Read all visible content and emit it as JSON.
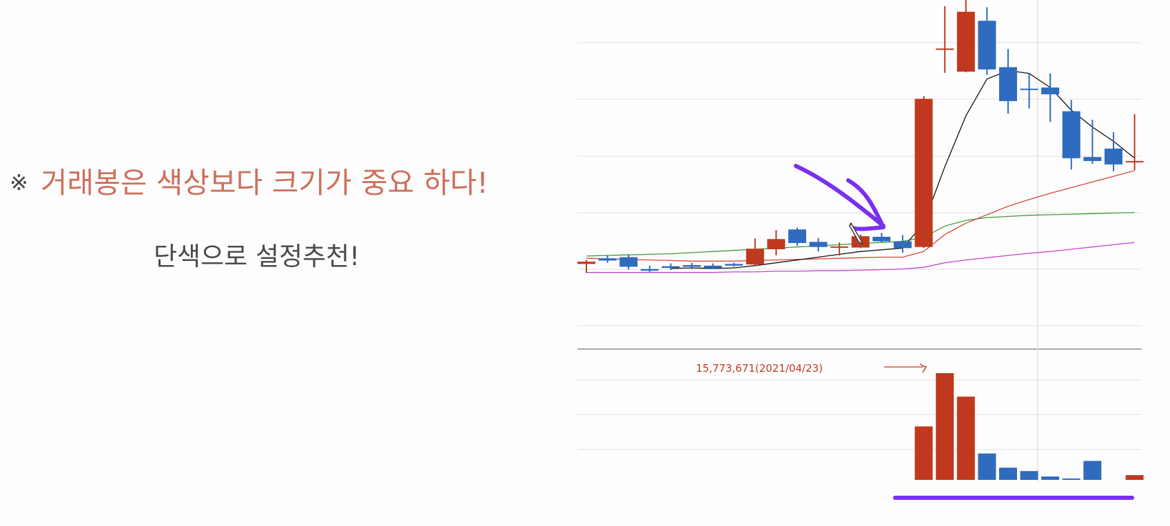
{
  "headline": {
    "mark": "※",
    "text": "거래봉은 색상보다 크기가 중요 하다!",
    "color": "#cf6f5c"
  },
  "subline": "단색으로 설정추천!",
  "chart_data": {
    "type": "candlestick",
    "colors": {
      "up": "#c0391e",
      "down": "#2f6bbf",
      "ma5": "#111111",
      "ma20": "#d9453a",
      "ma60": "#3a9a3a",
      "ma120": "#c844d0",
      "annotation": "#7b2ff0"
    },
    "candles": [
      {
        "o": 85.8,
        "h": 86.5,
        "l": 84.2,
        "c": 86.2
      },
      {
        "o": 86.8,
        "h": 87.3,
        "l": 86.0,
        "c": 86.4
      },
      {
        "o": 87.0,
        "h": 87.5,
        "l": 84.8,
        "c": 85.3
      },
      {
        "o": 84.9,
        "h": 85.5,
        "l": 84.3,
        "c": 84.6
      },
      {
        "o": 85.4,
        "h": 85.9,
        "l": 84.7,
        "c": 85.1
      },
      {
        "o": 85.6,
        "h": 86.0,
        "l": 84.9,
        "c": 85.3
      },
      {
        "o": 85.5,
        "h": 85.9,
        "l": 84.9,
        "c": 85.1
      },
      {
        "o": 85.8,
        "h": 86.0,
        "l": 85.3,
        "c": 85.5
      },
      {
        "o": 85.7,
        "h": 90.3,
        "l": 85.5,
        "c": 88.5
      },
      {
        "o": 88.4,
        "h": 91.8,
        "l": 87.3,
        "c": 90.2
      },
      {
        "o": 91.9,
        "h": 92.2,
        "l": 89.0,
        "c": 89.5
      },
      {
        "o": 89.7,
        "h": 90.4,
        "l": 88.0,
        "c": 88.8
      },
      {
        "o": 88.7,
        "h": 89.6,
        "l": 87.3,
        "c": 88.9
      },
      {
        "o": 88.7,
        "h": 91.0,
        "l": 88.6,
        "c": 90.7
      },
      {
        "o": 90.6,
        "h": 91.3,
        "l": 89.6,
        "c": 89.8
      },
      {
        "o": 89.8,
        "h": 90.9,
        "l": 87.8,
        "c": 88.6
      },
      {
        "o": 88.8,
        "h": 115.5,
        "l": 88.6,
        "c": 115.0
      },
      {
        "o": 123.8,
        "h": 131.4,
        "l": 119.6,
        "c": 123.9
      },
      {
        "o": 119.8,
        "h": 143.3,
        "l": 119.7,
        "c": 130.4
      },
      {
        "o": 128.8,
        "h": 131.2,
        "l": 119.2,
        "c": 120.2
      },
      {
        "o": 120.6,
        "h": 123.8,
        "l": 112.4,
        "c": 114.6
      },
      {
        "o": 116.8,
        "h": 119.4,
        "l": 113.3,
        "c": 116.7
      },
      {
        "o": 117.0,
        "h": 119.5,
        "l": 110.9,
        "c": 115.8
      },
      {
        "o": 112.8,
        "h": 114.8,
        "l": 102.5,
        "c": 104.5
      },
      {
        "o": 104.7,
        "h": 111.3,
        "l": 103.5,
        "c": 104.0
      },
      {
        "o": 106.2,
        "h": 109.1,
        "l": 102.2,
        "c": 103.4
      },
      {
        "o": 103.8,
        "h": 112.3,
        "l": 102.4,
        "c": 104.0
      }
    ],
    "ma5": [
      null,
      null,
      null,
      null,
      85.0,
      85.1,
      85.0,
      85.1,
      85.5,
      86.0,
      86.5,
      87.0,
      87.5,
      88.0,
      88.3,
      88.6,
      93.0,
      103.0,
      112.0,
      118.5,
      120.0,
      119.5,
      117.0,
      113.0,
      110.0,
      107.5,
      104.5
    ],
    "ma20": [
      86.8,
      86.7,
      86.6,
      86.5,
      86.4,
      86.3,
      86.3,
      86.3,
      86.4,
      86.5,
      86.6,
      86.7,
      86.8,
      86.9,
      87.0,
      87.0,
      88.0,
      91.0,
      93.0,
      94.5,
      96.0,
      97.2,
      98.3,
      99.3,
      100.3,
      101.3,
      102.3
    ],
    "ma60": [
      87.2,
      87.3,
      87.4,
      87.5,
      87.6,
      87.8,
      88.0,
      88.2,
      88.4,
      88.6,
      88.8,
      89.0,
      89.2,
      89.4,
      89.6,
      89.8,
      90.5,
      92.5,
      93.5,
      94.0,
      94.2,
      94.4,
      94.5,
      94.6,
      94.7,
      94.8,
      94.9
    ],
    "ma120": [
      84.3,
      84.3,
      84.3,
      84.3,
      84.3,
      84.3,
      84.3,
      84.4,
      84.4,
      84.5,
      84.5,
      84.6,
      84.6,
      84.7,
      84.8,
      84.9,
      85.2,
      86.0,
      86.5,
      86.9,
      87.3,
      87.7,
      88.0,
      88.4,
      88.8,
      89.2,
      89.6
    ],
    "volume": [
      0,
      0,
      0,
      0,
      0,
      0,
      0,
      0,
      0,
      0,
      0,
      0,
      0,
      0,
      0,
      0,
      7.9,
      15.77,
      12.3,
      3.9,
      1.8,
      1.3,
      0.5,
      0.15,
      2.8,
      0,
      0.7
    ],
    "volume_max": 15773671,
    "volume_annotation": "15,773,671(2021/04/23)"
  }
}
